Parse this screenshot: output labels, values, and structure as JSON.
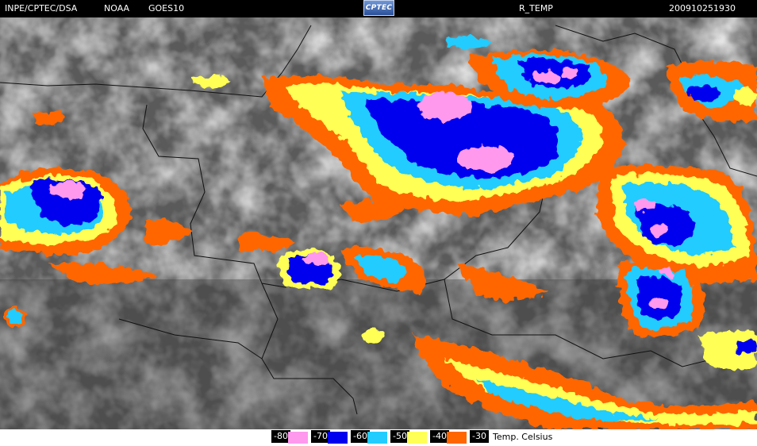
{
  "header": {
    "source": "INPE/CPTEC/DSA",
    "agency": "NOAA",
    "satellite": "GOES10",
    "logo_text": "CPTEC",
    "product": "R_TEMP",
    "timestamp": "200910251930"
  },
  "legend": {
    "unit_label": "Temp. Celsius",
    "entries": [
      {
        "label": "-80",
        "color": "#ff99ee"
      },
      {
        "label": "-70",
        "color": "#0000ee"
      },
      {
        "label": "-60",
        "color": "#22ccff"
      },
      {
        "label": "-50",
        "color": "#ffff55"
      },
      {
        "label": "-40",
        "color": "#ff6600"
      },
      {
        "label": "-30",
        "color": "#000000"
      }
    ]
  },
  "colors": {
    "minus80": "#ff99ee",
    "minus70": "#0000ee",
    "minus60": "#22ccff",
    "minus50": "#ffff55",
    "minus40": "#ff6600"
  }
}
